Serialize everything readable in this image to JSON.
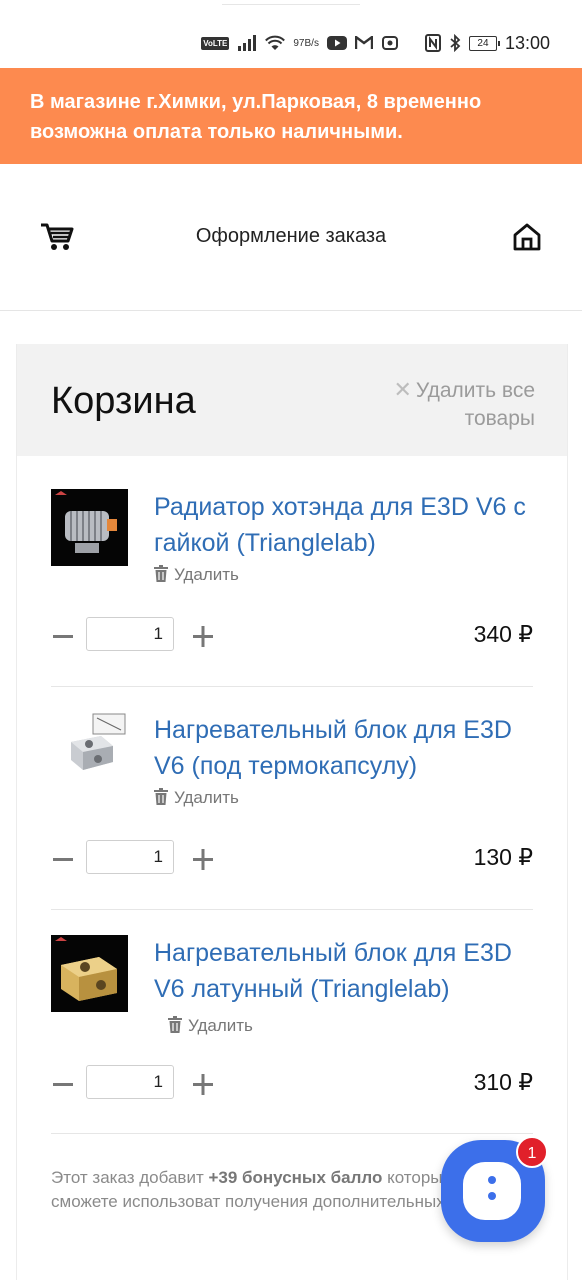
{
  "status_bar": {
    "volte": "VoLTE",
    "net_speed_value": "97",
    "net_speed_unit": "B/s",
    "battery": "24",
    "time": "13:00",
    "icons": [
      "volte-icon",
      "signal-icon",
      "wifi-icon",
      "youtube-icon",
      "gmail-icon",
      "shield-icon",
      "nfc-icon",
      "bluetooth-icon",
      "battery-icon"
    ]
  },
  "banner": {
    "text": "В магазине г.Химки, ул.Парковая, 8 временно возможна оплата только наличными.",
    "color": "#fd8a4f"
  },
  "header": {
    "title": "Оформление заказа",
    "left_icon": "cart-icon",
    "right_icon": "home-icon"
  },
  "cart": {
    "title": "Корзина",
    "clear_all": "Удалить все товары",
    "delete_label": "Удалить",
    "items": [
      {
        "name": "Радиатор хотэнда для E3D V6 с гайкой (Trianglelab)",
        "qty": "1",
        "price": "340 ₽"
      },
      {
        "name": "Нагревательный блок для E3D V6 (под термокапсулу)",
        "qty": "1",
        "price": "130 ₽"
      },
      {
        "name": "Нагревательный блок для E3D V6 латунный (Trianglelab)",
        "qty": "1",
        "price": "310 ₽"
      }
    ],
    "bonus": {
      "prefix": "Этот заказ добавит ",
      "points": "+39 бонусных балло",
      "suffix": " которые вы затем сможете использоват получения дополнительных скидок."
    }
  },
  "chat": {
    "badge": "1",
    "color": "#3c6fea"
  },
  "colors": {
    "link": "#2f6db5",
    "cart_header_bg": "#f2f2f2",
    "badge": "#e1202a"
  }
}
